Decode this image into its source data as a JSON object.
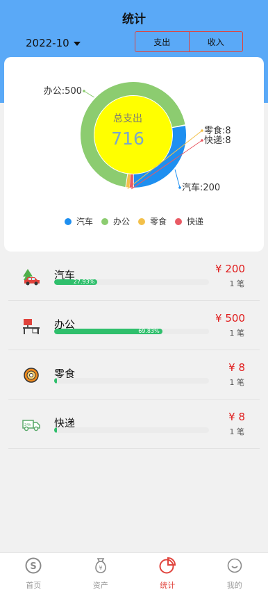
{
  "header": {
    "title": "统计",
    "month": "2022-10",
    "toggle": {
      "expense": "支出",
      "income": "收入"
    }
  },
  "chart_data": {
    "type": "pie",
    "center_label": "总支出",
    "center_value": "716",
    "slices": [
      {
        "name": "汽车",
        "value": 200,
        "color": "#1e8ff0",
        "label": "汽车:200"
      },
      {
        "name": "办公",
        "value": 500,
        "color": "#8ccc70",
        "label": "办公:500"
      },
      {
        "name": "零食",
        "value": 8,
        "color": "#f3c04a",
        "label": "零食:8"
      },
      {
        "name": "快递",
        "value": 8,
        "color": "#e95a64",
        "label": "快递:8"
      }
    ],
    "inner_color": "#ffff00",
    "legend_position": "bottom"
  },
  "categories": [
    {
      "name": "汽车",
      "amount": "¥ 200",
      "count": "1 笔",
      "percent": 27.93,
      "percent_label": "27.93%",
      "icon": "car-tree-icon"
    },
    {
      "name": "办公",
      "amount": "¥ 500",
      "count": "1 笔",
      "percent": 69.83,
      "percent_label": "69.83%",
      "icon": "office-desk-icon"
    },
    {
      "name": "零食",
      "amount": "¥ 8",
      "count": "1 笔",
      "percent": 1.12,
      "percent_label": "",
      "icon": "snack-donut-icon"
    },
    {
      "name": "快递",
      "amount": "¥ 8",
      "count": "1 笔",
      "percent": 1.12,
      "percent_label": "",
      "icon": "delivery-truck-icon"
    }
  ],
  "tabbar": [
    {
      "label": "首页",
      "icon": "home-coin-icon",
      "active": false
    },
    {
      "label": "资产",
      "icon": "assets-bag-icon",
      "active": false
    },
    {
      "label": "统计",
      "icon": "statistics-pie-icon",
      "active": true
    },
    {
      "label": "我的",
      "icon": "profile-smile-icon",
      "active": false
    }
  ],
  "colors": {
    "header": "#5aa9f7",
    "accent": "#e0433c",
    "progress": "#2fbf6c",
    "amount": "#e01b1b"
  }
}
